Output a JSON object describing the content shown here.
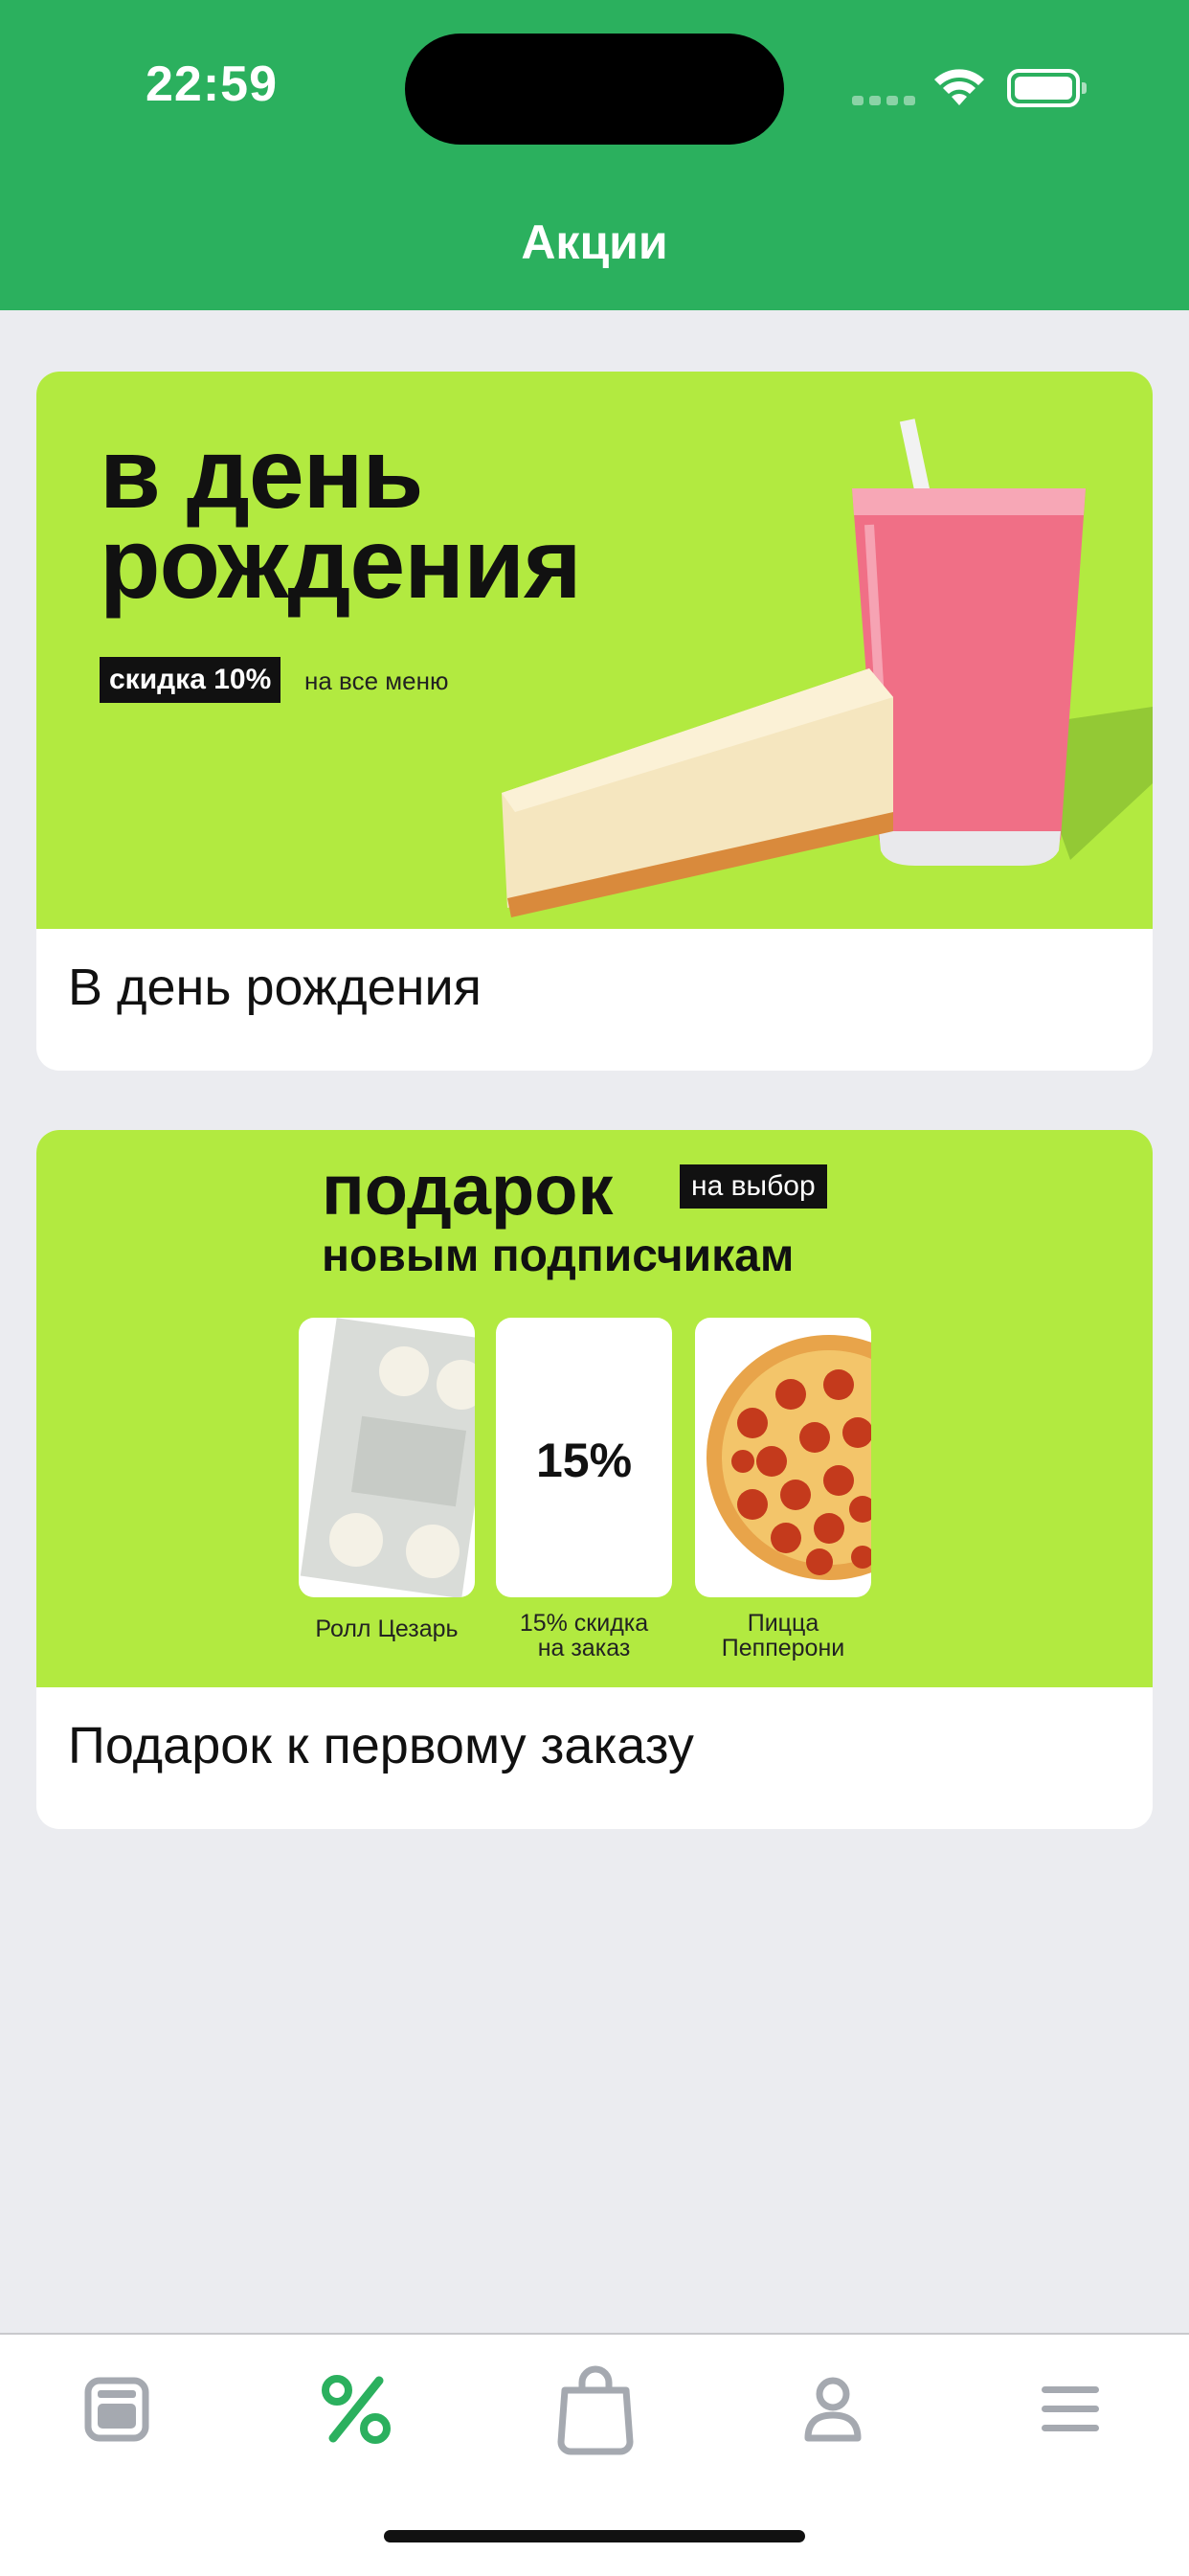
{
  "status_bar": {
    "time": "22:59"
  },
  "header": {
    "title": "Акции"
  },
  "promos": [
    {
      "caption": "В день рождения",
      "banner": {
        "headline_line1": "в день",
        "headline_line2": "рождения",
        "tag": "скидка 10%",
        "sub": "на все меню"
      }
    },
    {
      "caption": "Подарок к первому заказу",
      "banner": {
        "title": "подарок",
        "choice_tag": "на выбор",
        "subtitle": "новым подписчикам",
        "tiles": [
          {
            "label_line1": "Ролл Цезарь",
            "label_line2": ""
          },
          {
            "value": "15%",
            "label_line1": "15% скидка",
            "label_line2": "на заказ"
          },
          {
            "label_line1": "Пицца",
            "label_line2": "Пепперони"
          }
        ]
      }
    }
  ],
  "tabbar": {
    "tabs": [
      {
        "icon": "menu-card-icon",
        "active": false
      },
      {
        "icon": "percent-icon",
        "active": true
      },
      {
        "icon": "shopping-bag-icon",
        "active": false
      },
      {
        "icon": "profile-icon",
        "active": false
      },
      {
        "icon": "hamburger-icon",
        "active": false
      }
    ]
  },
  "colors": {
    "accent": "#2bb05e",
    "banner_bg": "#b2ea40",
    "inactive_icon": "#a5a9b0",
    "background": "#ebecf0"
  }
}
